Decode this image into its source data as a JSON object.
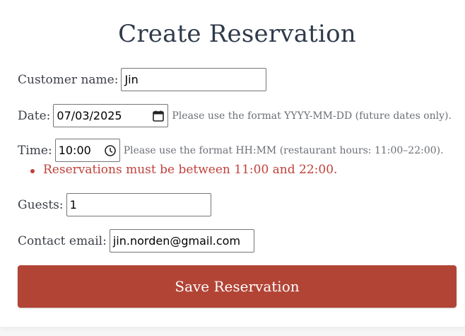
{
  "page": {
    "title": "Create Reservation"
  },
  "form": {
    "customer_name": {
      "label": "Customer name:",
      "value": "Jin"
    },
    "date": {
      "label": "Date:",
      "value": "07/03/2025",
      "hint": "Please use the format YYYY-MM-DD (future dates only).",
      "icon": "calendar-icon"
    },
    "time": {
      "label": "Time:",
      "value": "10:00",
      "hint": "Please use the format HH:MM (restaurant hours: 11:00–22:00).",
      "icon": "clock-icon"
    },
    "errors": [
      "Reservations must be between 11:00 and 22:00."
    ],
    "guests": {
      "label": "Guests:",
      "value": "1"
    },
    "contact_email": {
      "label": "Contact email:",
      "value": "jin.norden@gmail.com"
    },
    "save_label": "Save Reservation"
  },
  "colors": {
    "accent": "#b24436",
    "error": "#c0413b",
    "title": "#2f3a4b"
  }
}
